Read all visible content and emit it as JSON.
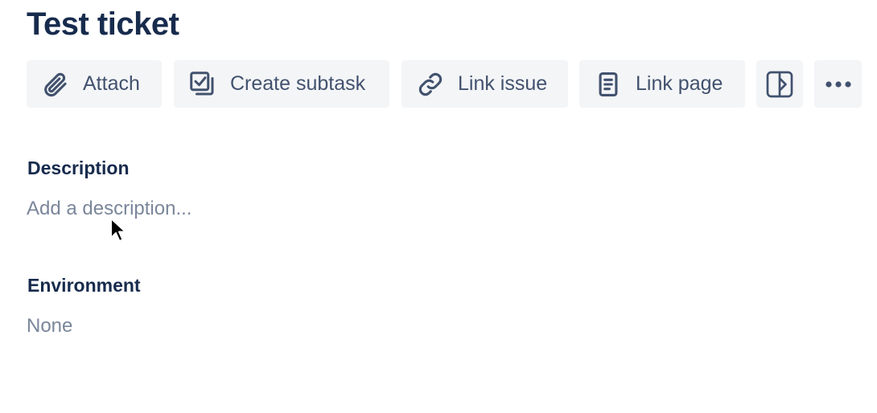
{
  "issue": {
    "title": "Test ticket"
  },
  "toolbar": {
    "attach_label": "Attach",
    "create_subtask_label": "Create subtask",
    "link_issue_label": "Link issue",
    "link_page_label": "Link page"
  },
  "fields": {
    "description": {
      "heading": "Description",
      "placeholder": "Add a description..."
    },
    "environment": {
      "heading": "Environment",
      "value": "None"
    }
  },
  "colors": {
    "heading": "#172b4d",
    "button_bg": "#f4f5f7",
    "button_text": "#42526e",
    "placeholder": "#7a869a"
  },
  "icons": {
    "attach": "paperclip-icon",
    "create_subtask": "subtask-icon",
    "link_issue": "link-icon",
    "link_page": "page-icon",
    "app": "sidebar-app-icon",
    "more": "more-horizontal-icon"
  }
}
